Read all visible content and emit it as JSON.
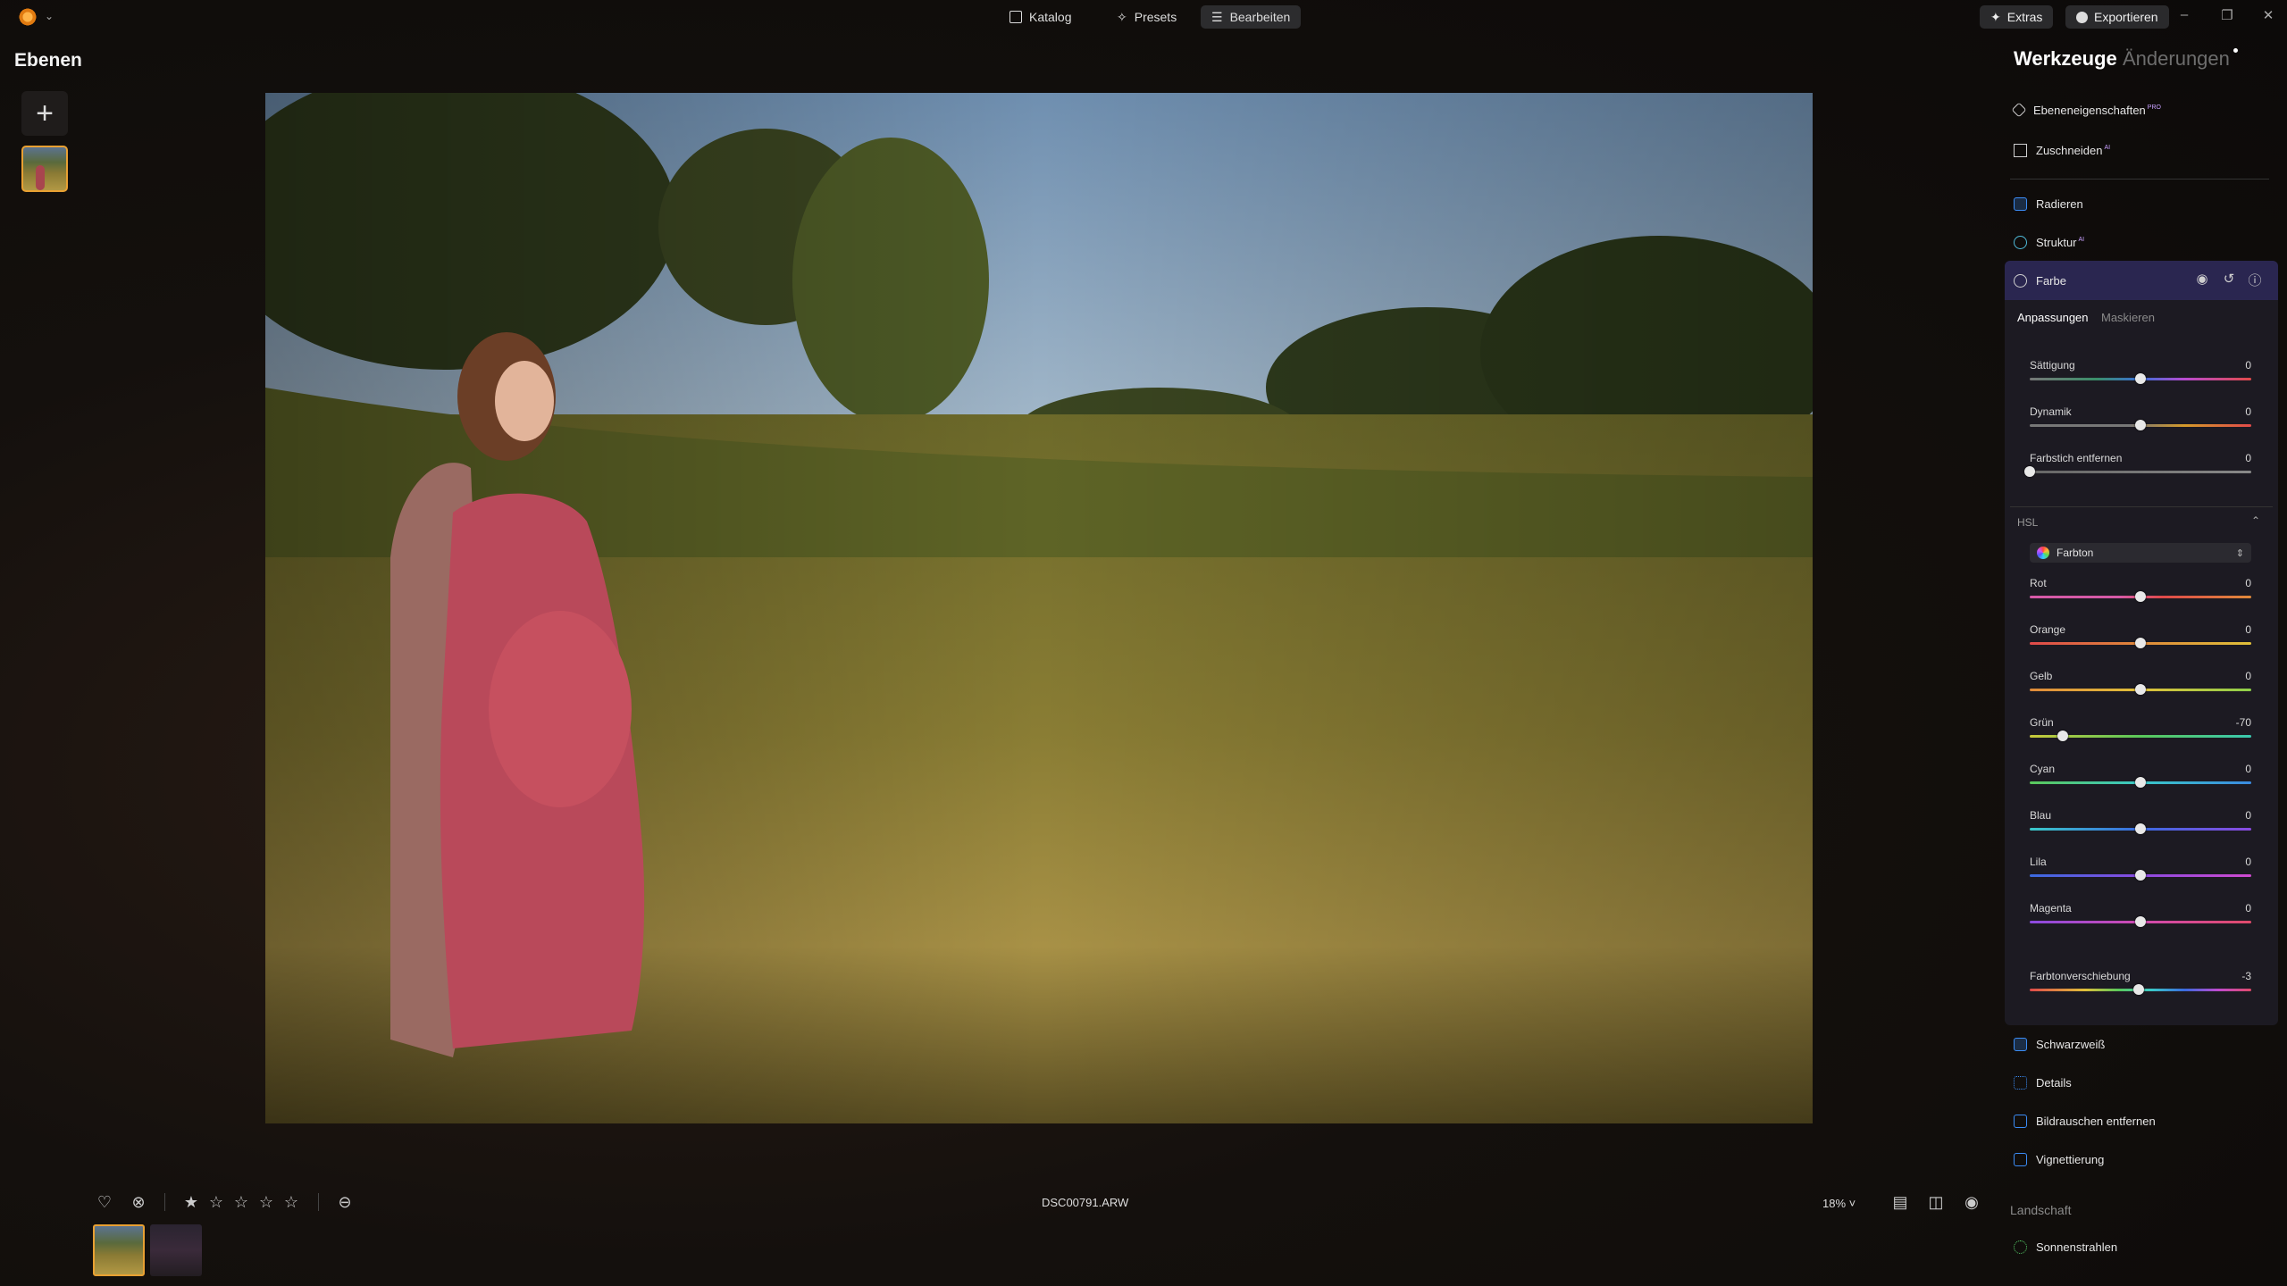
{
  "topbar": {
    "nav": [
      {
        "label": "Katalog",
        "icon": "folder-icon"
      },
      {
        "label": "Presets",
        "icon": "sparkle-icon"
      },
      {
        "label": "Bearbeiten",
        "icon": "sliders-icon"
      }
    ],
    "extras_label": "Extras",
    "export_label": "Exportieren"
  },
  "layers": {
    "title": "Ebenen"
  },
  "bottom": {
    "filename": "DSC00791.ARW",
    "zoom": "18% ˅",
    "rating": 1
  },
  "panel": {
    "title": "Werkzeuge",
    "title2": "Änderungen",
    "tools_top": [
      {
        "label": "Ebeneneigenschaften",
        "badge": "PRO"
      },
      {
        "label": "Zuschneiden",
        "badge": "AI"
      },
      {
        "label": "Radieren",
        "badge": ""
      },
      {
        "label": "Struktur",
        "badge": "AI"
      }
    ],
    "farbe": {
      "label": "Farbe",
      "tabs": [
        "Anpassungen",
        "Maskieren"
      ],
      "sliders": [
        {
          "label": "Sättigung",
          "value": "0",
          "pos": 0.5
        },
        {
          "label": "Dynamik",
          "value": "0",
          "pos": 0.5
        },
        {
          "label": "Farbstich entfernen",
          "value": "0",
          "pos": 0.0
        }
      ],
      "hsl_label": "HSL",
      "hsl_select": "Farbton",
      "hsl_sliders": [
        {
          "label": "Rot",
          "value": "0",
          "pos": 0.5
        },
        {
          "label": "Orange",
          "value": "0",
          "pos": 0.5
        },
        {
          "label": "Gelb",
          "value": "0",
          "pos": 0.5
        },
        {
          "label": "Grün",
          "value": "-70",
          "pos": 0.15
        },
        {
          "label": "Cyan",
          "value": "0",
          "pos": 0.5
        },
        {
          "label": "Blau",
          "value": "0",
          "pos": 0.5
        },
        {
          "label": "Lila",
          "value": "0",
          "pos": 0.5
        },
        {
          "label": "Magenta",
          "value": "0",
          "pos": 0.5
        }
      ],
      "shift": {
        "label": "Farbtonverschiebung",
        "value": "-3",
        "pos": 0.49
      }
    },
    "tools_bottom": [
      {
        "label": "Schwarzweiß"
      },
      {
        "label": "Details"
      },
      {
        "label": "Bildrauschen entfernen"
      },
      {
        "label": "Vignettierung"
      }
    ],
    "section": "Landschaft",
    "section_tools": [
      {
        "label": "Sonnenstrahlen"
      }
    ]
  }
}
